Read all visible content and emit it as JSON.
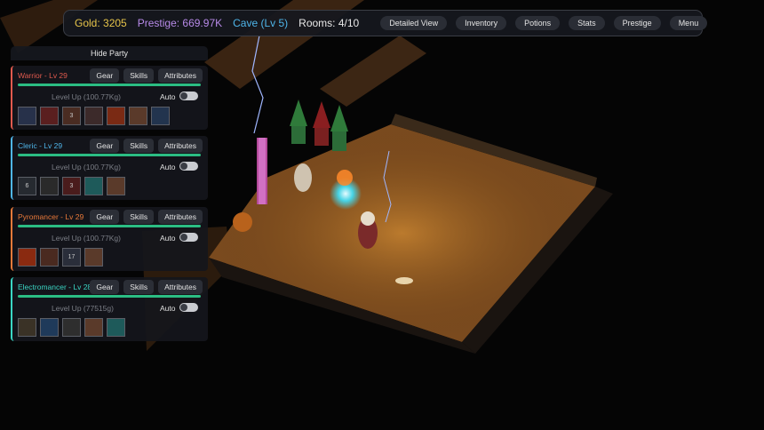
{
  "topbar": {
    "gold": "Gold: 3205",
    "prestige": "Prestige: 669.97K",
    "location": "Cave (Lv 5)",
    "rooms": "Rooms: 4/10",
    "buttons": [
      "Detailed View",
      "Inventory",
      "Potions",
      "Stats",
      "Prestige",
      "Menu"
    ]
  },
  "party": {
    "hide_label": "Hide Party",
    "tabs": [
      "Gear",
      "Skills",
      "Attributes"
    ],
    "auto_label": "Auto",
    "heroes": [
      {
        "name": "Warrior - Lv 29",
        "color": "#e15a4e",
        "xp_progress": 1.0,
        "level_up": "Level Up (100.77Kg)",
        "skills": [
          {
            "icon": "shield-skill-icon",
            "color": "#27314a",
            "text": ""
          },
          {
            "icon": "slash-skill-icon",
            "color": "#5a1f1f",
            "text": ""
          },
          {
            "icon": "shout-skill-icon",
            "color": "#4a2c22",
            "text": "3"
          },
          {
            "icon": "armor-skill-icon",
            "color": "#3c2a2a",
            "text": ""
          },
          {
            "icon": "fury-skill-icon",
            "color": "#7a2a14",
            "text": ""
          },
          {
            "icon": "eye-skill-icon",
            "color": "#5a3a2a",
            "text": ""
          },
          {
            "icon": "star-skill-icon",
            "color": "#22344e",
            "text": ""
          }
        ]
      },
      {
        "name": "Cleric - Lv 29",
        "color": "#4fb6ea",
        "xp_progress": 1.0,
        "level_up": "Level Up (100.77Kg)",
        "skills": [
          {
            "icon": "prayer-skill-icon",
            "color": "#262a30",
            "text": "6"
          },
          {
            "icon": "bless-skill-icon",
            "color": "#2a2a2a",
            "text": ""
          },
          {
            "icon": "smite-skill-icon",
            "color": "#4a1c1c",
            "text": "3"
          },
          {
            "icon": "heal-skill-icon",
            "color": "#1e5a5a",
            "text": ""
          },
          {
            "icon": "eye-skill-icon",
            "color": "#5a3a2a",
            "text": ""
          }
        ]
      },
      {
        "name": "Pyromancer - Lv 29",
        "color": "#ea7a3a",
        "xp_progress": 1.0,
        "level_up": "Level Up (100.77Kg)",
        "skills": [
          {
            "icon": "fireball-skill-icon",
            "color": "#8a2a10",
            "text": ""
          },
          {
            "icon": "flame-skill-icon",
            "color": "#4a2a20",
            "text": ""
          },
          {
            "icon": "meteor-skill-icon",
            "color": "#2a2e3a",
            "text": "17"
          },
          {
            "icon": "eye-skill-icon",
            "color": "#5a3a2a",
            "text": ""
          }
        ]
      },
      {
        "name": "Electromancer - Lv 28",
        "color": "#3ad6c4",
        "xp_progress": 1.0,
        "level_up": "Level Up (77515g)",
        "skills": [
          {
            "icon": "spark-skill-icon",
            "color": "#3a3226",
            "text": ""
          },
          {
            "icon": "lightning-skill-icon",
            "color": "#1f3a5a",
            "text": ""
          },
          {
            "icon": "storm-skill-icon",
            "color": "#2e2e2e",
            "text": ""
          },
          {
            "icon": "eye-skill-icon",
            "color": "#5a3a2a",
            "text": ""
          },
          {
            "icon": "surge-skill-icon",
            "color": "#1e5a5a",
            "text": ""
          }
        ]
      }
    ]
  }
}
